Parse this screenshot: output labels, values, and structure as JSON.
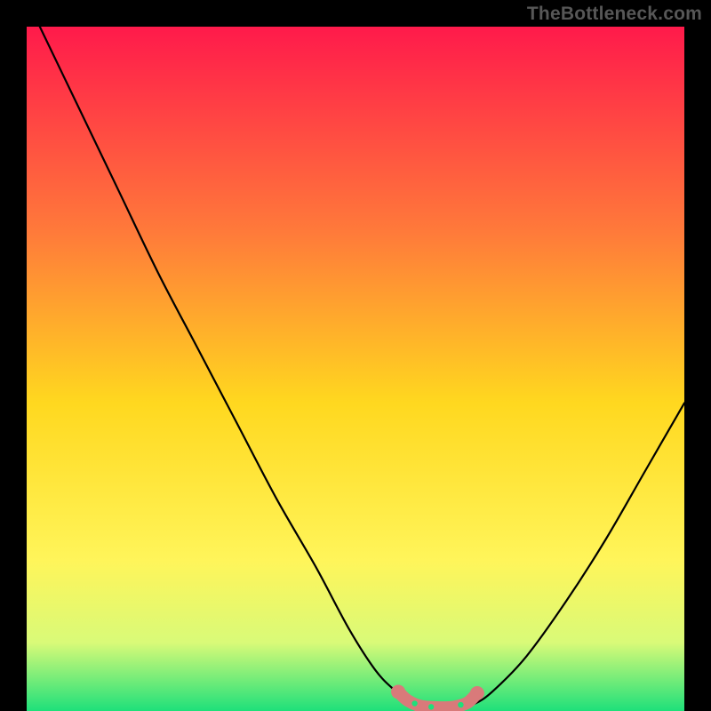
{
  "watermark": "TheBottleneck.com",
  "colors": {
    "bg_black": "#000000",
    "watermark": "#575757",
    "grad_top": "#ff1a4b",
    "grad_mid1": "#ff7a3a",
    "grad_mid2": "#ffd81f",
    "grad_low1": "#fff55a",
    "grad_low2": "#d9fa78",
    "grad_bottom": "#1ee07a",
    "curve": "#000000",
    "marker": "#d97a7a"
  },
  "chart_data": {
    "type": "line",
    "title": "",
    "xlabel": "",
    "ylabel": "",
    "xlim": [
      0,
      100
    ],
    "ylim": [
      0,
      100
    ],
    "series": [
      {
        "name": "bottleneck-curve",
        "x": [
          2,
          8,
          14,
          20,
          26,
          32,
          38,
          44,
          49,
          53,
          56,
          59,
          62,
          65,
          68,
          71,
          76,
          82,
          88,
          94,
          100
        ],
        "y": [
          100,
          88,
          76,
          64,
          53,
          42,
          31,
          21,
          12,
          6,
          3,
          1,
          0.5,
          0.5,
          1,
          3,
          8,
          16,
          25,
          35,
          45
        ]
      }
    ],
    "markers": {
      "name": "highlight-segment",
      "x": [
        56.5,
        58,
        60,
        63,
        65,
        67,
        68.5
      ],
      "y": [
        2.8,
        1.5,
        0.7,
        0.5,
        0.6,
        1.2,
        2.6
      ]
    }
  }
}
